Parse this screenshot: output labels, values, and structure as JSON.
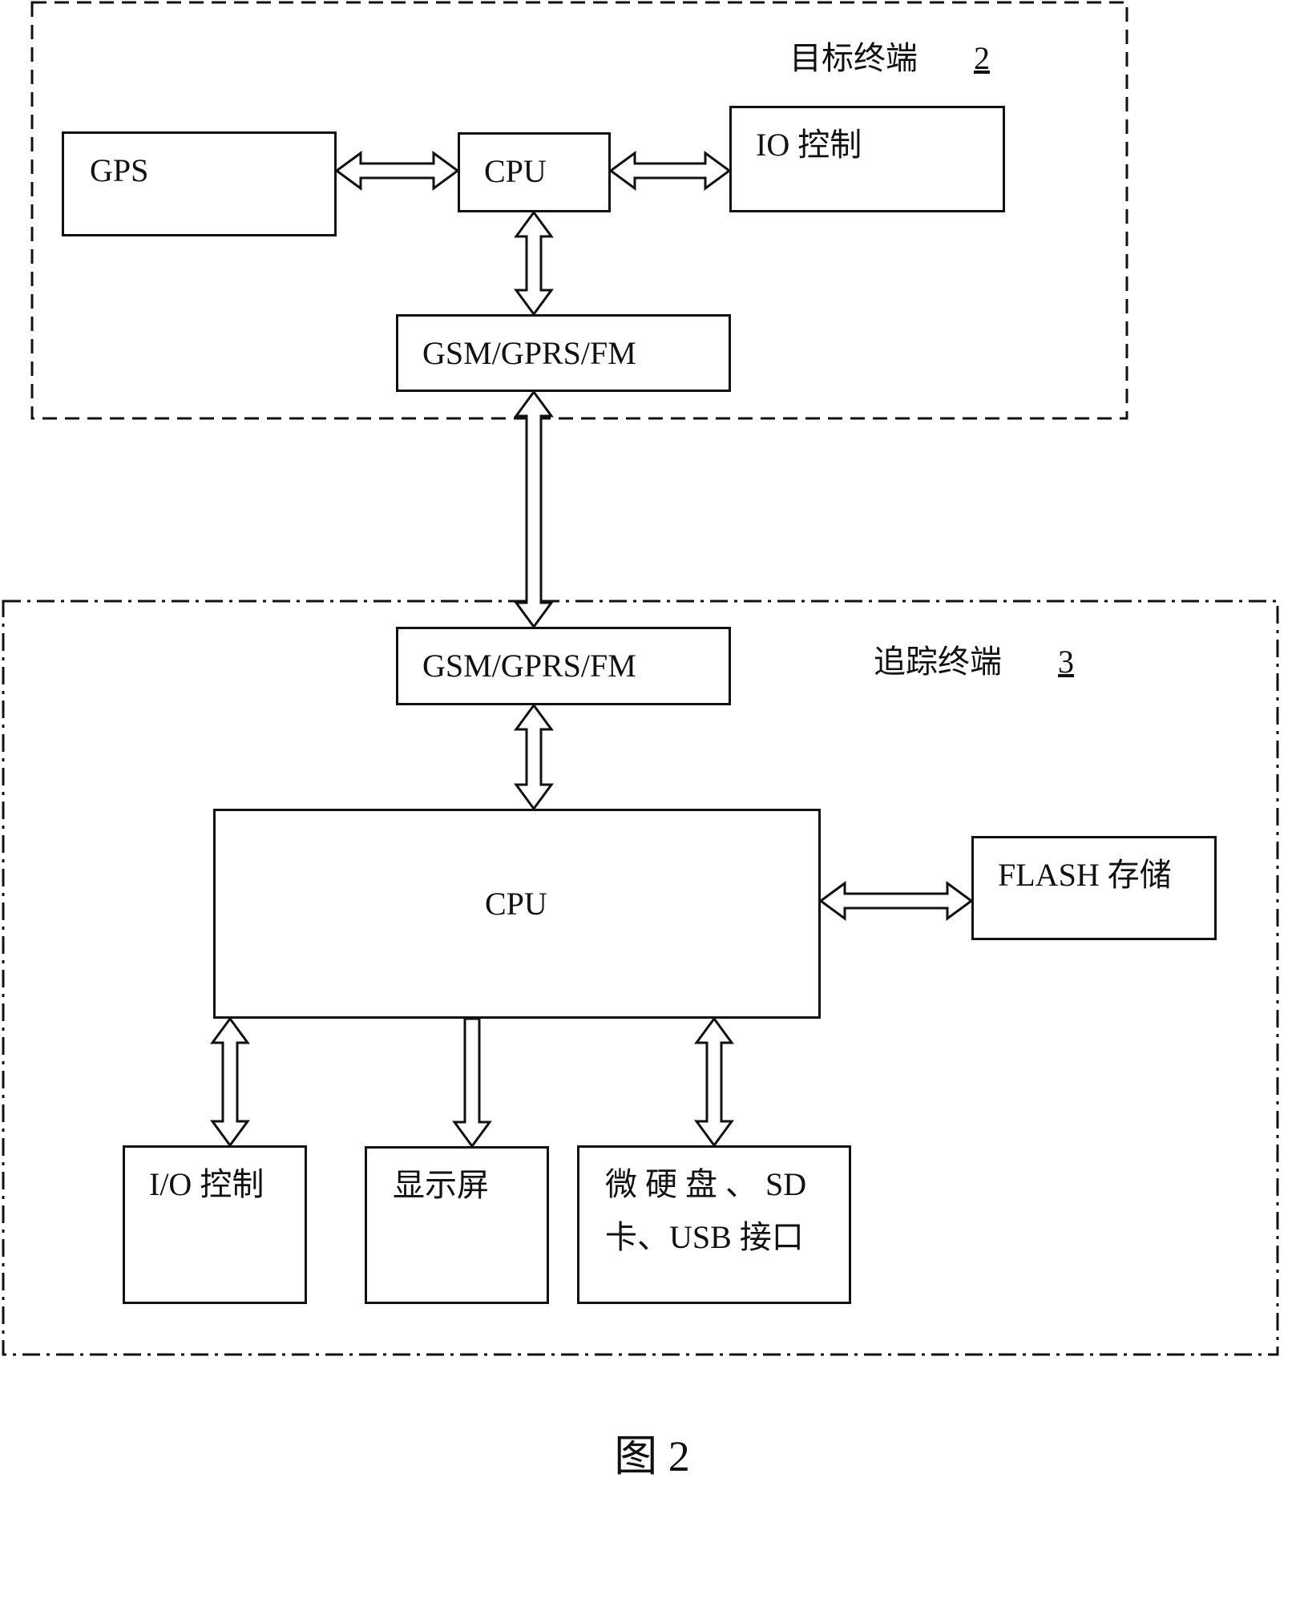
{
  "diagram": {
    "caption": "图 2",
    "target_terminal": {
      "title": "目标终端",
      "ref_num": "2",
      "blocks": {
        "gps": "GPS",
        "cpu": "CPU",
        "io": "IO 控制",
        "comm": "GSM/GPRS/FM"
      }
    },
    "tracking_terminal": {
      "title": "追踪终端",
      "ref_num": "3",
      "blocks": {
        "comm": "GSM/GPRS/FM",
        "cpu": "CPU",
        "flash": "FLASH 存储",
        "io": "I/O 控制",
        "display": "显示屏",
        "storage_line1": "微 硬 盘 、 SD",
        "storage_line2": "卡、USB 接口"
      }
    },
    "connections": [
      {
        "from": "target.gps",
        "to": "target.cpu",
        "type": "bidirectional"
      },
      {
        "from": "target.cpu",
        "to": "target.io",
        "type": "bidirectional"
      },
      {
        "from": "target.cpu",
        "to": "target.comm",
        "type": "bidirectional"
      },
      {
        "from": "target.comm",
        "to": "tracking.comm",
        "type": "bidirectional"
      },
      {
        "from": "tracking.comm",
        "to": "tracking.cpu",
        "type": "bidirectional"
      },
      {
        "from": "tracking.cpu",
        "to": "tracking.flash",
        "type": "bidirectional"
      },
      {
        "from": "tracking.cpu",
        "to": "tracking.io",
        "type": "bidirectional"
      },
      {
        "from": "tracking.cpu",
        "to": "tracking.display",
        "type": "unidirectional"
      },
      {
        "from": "tracking.cpu",
        "to": "tracking.storage",
        "type": "bidirectional"
      }
    ]
  }
}
